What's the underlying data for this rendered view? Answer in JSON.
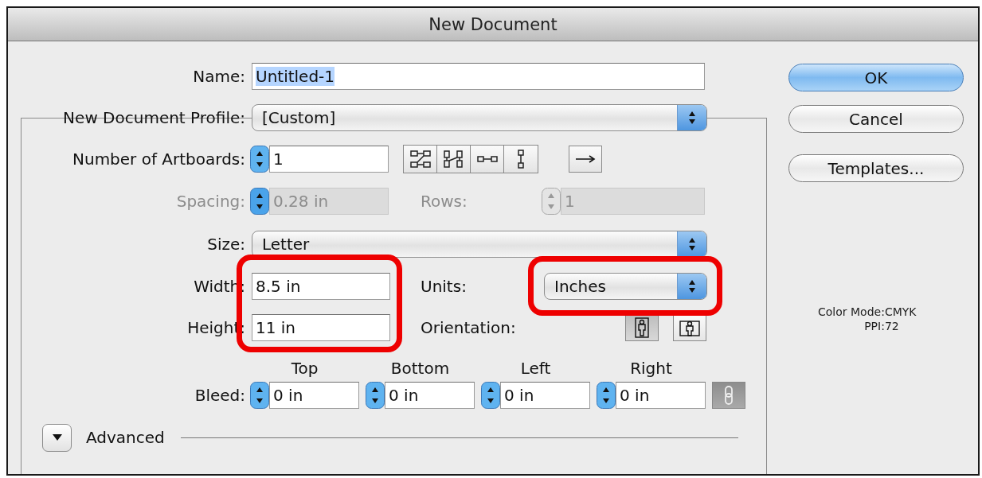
{
  "window": {
    "title": "New Document"
  },
  "name": {
    "label": "Name:",
    "value": "Untitled-1",
    "text_selected": true
  },
  "profile": {
    "label": "New Document Profile:",
    "value": "[Custom]"
  },
  "artboards": {
    "label": "Number of Artboards:",
    "value": "1"
  },
  "spacing": {
    "label": "Spacing:",
    "value": "0.28 in",
    "disabled": true
  },
  "rows": {
    "label": "Rows:",
    "value": "1",
    "disabled": true
  },
  "size": {
    "label": "Size:",
    "value": "Letter"
  },
  "width": {
    "label": "Width:",
    "value": "8.5 in"
  },
  "units": {
    "label": "Units:",
    "value": "Inches"
  },
  "height": {
    "label": "Height:",
    "value": "11 in"
  },
  "orientation": {
    "label": "Orientation:",
    "options": [
      {
        "kind": "portrait",
        "selected": true
      },
      {
        "kind": "landscape",
        "selected": false
      }
    ]
  },
  "bleed": {
    "label": "Bleed:",
    "linked": true,
    "sides": [
      {
        "heading": "Top",
        "value": "0 in"
      },
      {
        "heading": "Bottom",
        "value": "0 in"
      },
      {
        "heading": "Left",
        "value": "0 in"
      },
      {
        "heading": "Right",
        "value": "0 in"
      }
    ]
  },
  "advanced": {
    "label": "Advanced",
    "expanded": false
  },
  "buttons": [
    {
      "label": "OK",
      "default": true
    },
    {
      "label": "Cancel",
      "default": false
    },
    {
      "label": "Templates...",
      "default": false
    }
  ],
  "info": [
    {
      "label": "Color Mode:",
      "value": "CMYK"
    },
    {
      "label": "PPI:",
      "value": "72"
    }
  ],
  "highlights": {
    "dimensions": true,
    "units": true
  }
}
